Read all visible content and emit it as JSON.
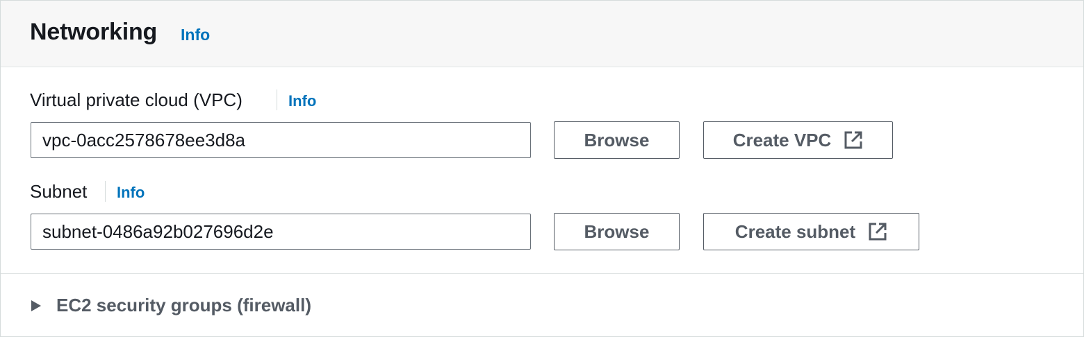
{
  "header": {
    "title": "Networking",
    "info_link": "Info"
  },
  "vpc": {
    "label": "Virtual private cloud (VPC)",
    "info_link": "Info",
    "value": "vpc-0acc2578678ee3d8a",
    "browse_label": "Browse",
    "create_label": "Create VPC",
    "create_icon": "external-link-icon"
  },
  "subnet": {
    "label": "Subnet",
    "info_link": "Info",
    "value": "subnet-0486a92b027696d2e",
    "browse_label": "Browse",
    "create_label": "Create subnet",
    "create_icon": "external-link-icon"
  },
  "security_groups": {
    "label": "EC2 security groups (firewall)",
    "expanded": false,
    "icon": "caret-right-icon"
  },
  "colors": {
    "link": "#0073bb",
    "button_text": "#545b64",
    "header_bg": "#f7f7f7"
  }
}
